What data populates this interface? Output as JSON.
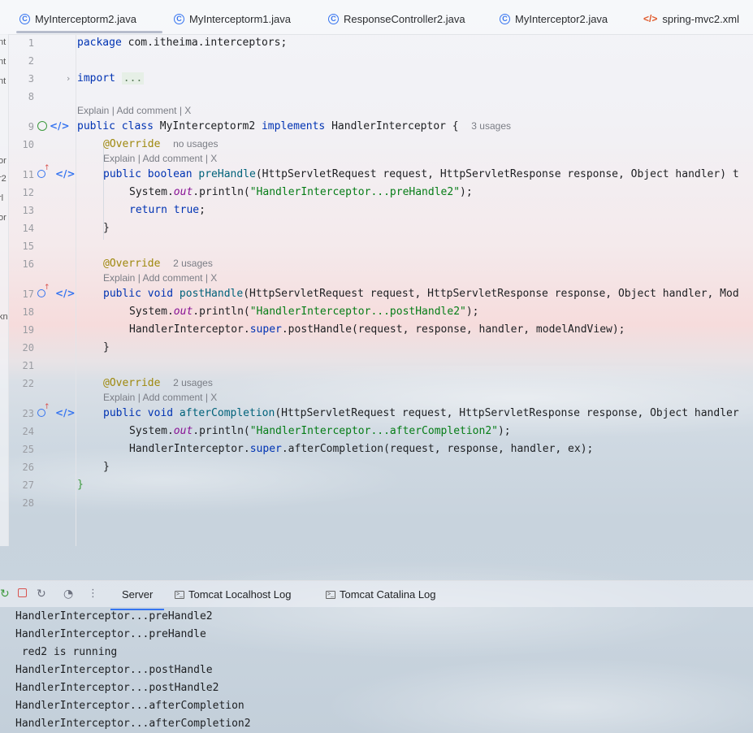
{
  "tabs": [
    {
      "label": "MyInterceptorm2.java",
      "icon": "class-icon",
      "active": true
    },
    {
      "label": "MyInterceptorm1.java",
      "icon": "class-icon"
    },
    {
      "label": "ResponseController2.java",
      "icon": "class-icon"
    },
    {
      "label": "MyInterceptor2.java",
      "icon": "class-icon"
    },
    {
      "label": "spring-mvc2.xml",
      "icon": "xml-icon"
    }
  ],
  "left_strip": [
    "nt",
    "nt",
    "nt",
    "or",
    "r2",
    "rl",
    "or",
    "kn"
  ],
  "line_numbers": [
    "1",
    "2",
    "3",
    "8",
    "9",
    "10",
    "11",
    "12",
    "13",
    "14",
    "15",
    "16",
    "17",
    "18",
    "19",
    "20",
    "21",
    "22",
    "23",
    "24",
    "25",
    "26",
    "27",
    "28"
  ],
  "code": {
    "l1_kw": "package",
    "l1_rest": " com.itheima.interceptors;",
    "l3_kw": "import",
    "l3_fold": "...",
    "hint": "Explain | Add comment | X",
    "l9_kw": "public class",
    "l9_name": " MyInterceptorm2 ",
    "l9_impl": "implements",
    "l9_iface": " HandlerInterceptor {",
    "usage_3": "3 usages",
    "override": "@Override",
    "no_usages": "no usages",
    "usage_2": "2 usages",
    "l11_kw": "public boolean",
    "l11_m": " preHandle",
    "l11_rest": "(HttpServletRequest request, HttpServletResponse response, Object handler) t",
    "sys": "System.",
    "out": "out",
    "println": ".println(",
    "s12": "\"HandlerInterceptor...preHandle2\"",
    "close": ");",
    "l13_kw": "return",
    "l13_v": " true",
    "semi": ";",
    "brace": "}",
    "l17_kw": "public void",
    "l17_m": " postHandle",
    "l17_rest": "(HttpServletRequest request, HttpServletResponse response, Object handler, Mod",
    "s18": "\"HandlerInterceptor...postHandle2\"",
    "l19_a": "HandlerInterceptor.",
    "l19_super": "super",
    "l19_b": ".postHandle(request, response, handler, modelAndView);",
    "l23_kw": "public void",
    "l23_m": " afterCompletion",
    "l23_rest": "(HttpServletRequest request, HttpServletResponse response, Object handler",
    "s24": "\"HandlerInterceptor...afterCompletion2\"",
    "l25_b": ".afterCompletion(request, response, handler, ex);"
  },
  "run_tabs": [
    {
      "label": "Server",
      "active": true
    },
    {
      "label": "Tomcat Localhost Log"
    },
    {
      "label": "Tomcat Catalina Log"
    }
  ],
  "console": [
    "HandlerInterceptor...preHandle2",
    "HandlerInterceptor...preHandle",
    " red2 is running",
    "HandlerInterceptor...postHandle",
    "HandlerInterceptor...postHandle2",
    "HandlerInterceptor...afterCompletion",
    "HandlerInterceptor...afterCompletion2"
  ]
}
